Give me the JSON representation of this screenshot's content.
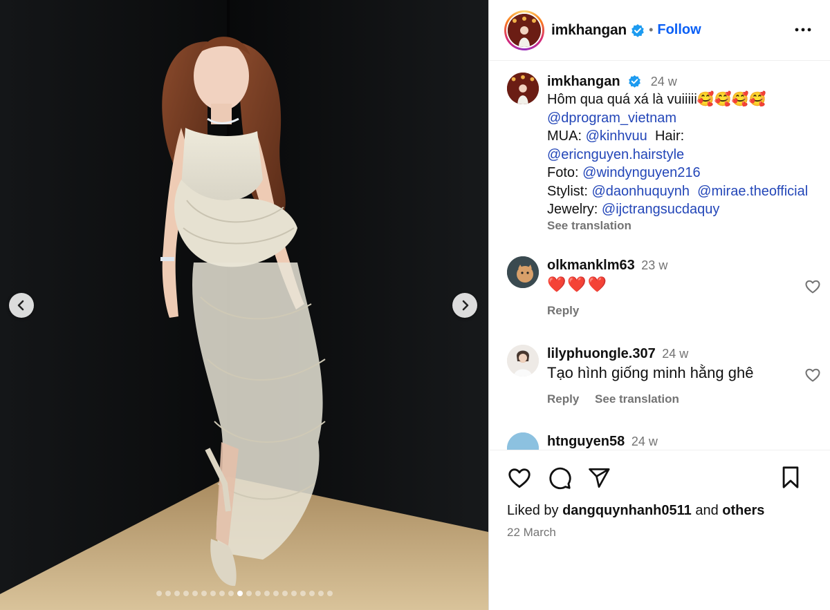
{
  "post": {
    "username": "imkhangan",
    "follow_label": "Follow",
    "separator": "•",
    "slide_count": 20,
    "active_slide": 9
  },
  "caption": {
    "username": "imkhangan",
    "time": "24 w",
    "text_line1": "Hôm qua quá xá là vuiiiii🥰🥰🥰🥰",
    "mention_program": "@dprogram_vietnam",
    "mua_label": "MUA:",
    "mua_mention": "@kinhvuu",
    "hair_label": "Hair:",
    "hair_mention": "@ericnguyen.hairstyle",
    "foto_label": "Foto:",
    "foto_mention": "@windynguyen216",
    "stylist_label": "Stylist:",
    "stylist_mention_1": "@daonhuquynh",
    "stylist_mention_2": "@mirae.theofficial",
    "jewelry_label": "Jewelry:",
    "jewelry_mention": "@ijctrangsucdaquy",
    "see_translation": "See translation"
  },
  "comments": [
    {
      "username": "olkmanklm63",
      "time": "23 w",
      "text": "❤️❤️❤️",
      "reply": "Reply",
      "translate": ""
    },
    {
      "username": "lilyphuongle.307",
      "time": "24 w",
      "text": "Tạo hình giống minh hằng ghê",
      "reply": "Reply",
      "translate": "See translation"
    },
    {
      "username": "htnguyen58",
      "time": "24 w",
      "text": "",
      "reply": "",
      "translate": ""
    }
  ],
  "footer": {
    "liked_by_prefix": "Liked by",
    "liked_by_user": "dangquynhanh0511",
    "and_label": "and",
    "others_label": "others",
    "date": "22 March"
  },
  "icons": {
    "verified": "verified-badge-icon",
    "more": "more-options-icon",
    "like": "heart-icon",
    "comment": "comment-icon",
    "share": "share-icon",
    "save": "bookmark-icon",
    "prev": "chevron-left-icon",
    "next": "chevron-right-icon"
  },
  "colors": {
    "link": "#2346b8",
    "follow": "#0a5ff5",
    "muted": "#737373",
    "verified": "#1d9bf0"
  }
}
